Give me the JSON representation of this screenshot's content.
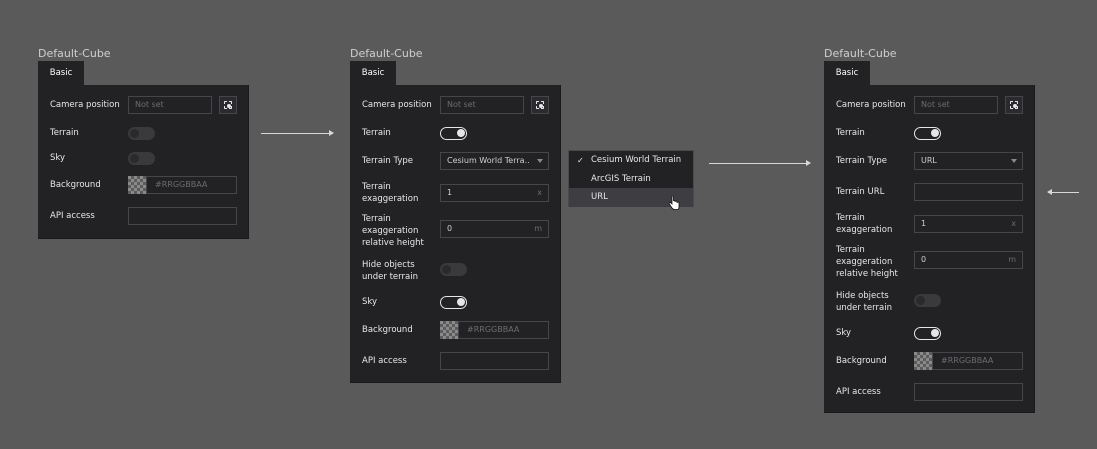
{
  "panel_left": {
    "title": "Default-Cube",
    "tab": "Basic",
    "camera_position": {
      "label": "Camera position",
      "placeholder": "Not set"
    },
    "terrain": {
      "label": "Terrain",
      "enabled": false
    },
    "sky": {
      "label": "Sky",
      "enabled": false
    },
    "background": {
      "label": "Background",
      "placeholder": "#RRGGBBAA"
    },
    "api_access": {
      "label": "API access",
      "value": ""
    }
  },
  "panel_middle": {
    "title": "Default-Cube",
    "tab": "Basic",
    "camera_position": {
      "label": "Camera position",
      "placeholder": "Not set"
    },
    "terrain": {
      "label": "Terrain",
      "enabled": true
    },
    "terrain_type": {
      "label": "Terrain Type",
      "value": "Cesium World Terra.."
    },
    "terrain_exaggeration": {
      "label_line1": "Terrain",
      "label_line2": "exaggeration",
      "value": "1",
      "suffix": "x"
    },
    "terrain_relative_height": {
      "label_line1": "Terrain",
      "label_line2": "exaggeration",
      "label_line3": "relative height",
      "value": "0",
      "suffix": "m"
    },
    "hide_objects": {
      "label_line1": "Hide objects",
      "label_line2": "under terrain",
      "enabled": false
    },
    "sky": {
      "label": "Sky",
      "enabled": true
    },
    "background": {
      "label": "Background",
      "placeholder": "#RRGGBBAA"
    },
    "api_access": {
      "label": "API access",
      "value": ""
    }
  },
  "dropdown": {
    "check": "✓",
    "options": [
      "Cesium World Terrain",
      "ArcGIS Terrain",
      "URL"
    ],
    "selected": "Cesium World Terrain",
    "hovered": "URL"
  },
  "panel_right": {
    "title": "Default-Cube",
    "tab": "Basic",
    "camera_position": {
      "label": "Camera position",
      "placeholder": "Not set"
    },
    "terrain": {
      "label": "Terrain",
      "enabled": true
    },
    "terrain_type": {
      "label": "Terrain Type",
      "value": "URL"
    },
    "terrain_url": {
      "label": "Terrain URL",
      "value": ""
    },
    "terrain_exaggeration": {
      "label_line1": "Terrain",
      "label_line2": "exaggeration",
      "value": "1",
      "suffix": "x"
    },
    "terrain_relative_height": {
      "label_line1": "Terrain",
      "label_line2": "exaggeration",
      "label_line3": "relative height",
      "value": "0",
      "suffix": "m"
    },
    "hide_objects": {
      "label_line1": "Hide objects",
      "label_line2": "under terrain",
      "enabled": false
    },
    "sky": {
      "label": "Sky",
      "enabled": true
    },
    "background": {
      "label": "Background",
      "placeholder": "#RRGGBBAA"
    },
    "api_access": {
      "label": "API access",
      "value": ""
    }
  },
  "colors": {
    "canvas": "#5a5a5a",
    "panel": "#222225",
    "field_border": "#45454a",
    "text": "#e8e8e8",
    "placeholder": "#6c6c70"
  }
}
